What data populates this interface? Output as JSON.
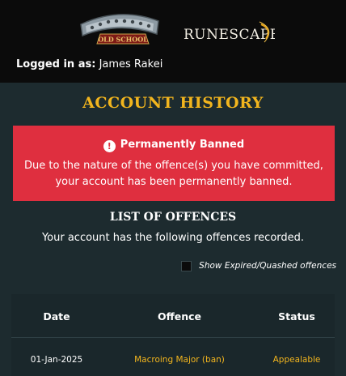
{
  "header": {
    "osrs_logo": {
      "text_top": "RuneScape",
      "text_bottom": "OLD SCHOOL"
    },
    "rs_logo": {
      "text": "RUNESCAPE"
    },
    "logged_in_label": "Logged in as:",
    "username": "James Rakei"
  },
  "page": {
    "title": "ACCOUNT HISTORY"
  },
  "ban_notice": {
    "icon": "exclamation-icon",
    "heading": "Permanently Banned",
    "message": "Due to the nature of the offence(s) you have committed, your account has been permanently banned.",
    "color": "#df2f3f"
  },
  "offences": {
    "title": "LIST OF OFFENCES",
    "subtitle": "Your account has the following offences recorded.",
    "show_expired_label": "Show Expired/Quashed offences",
    "show_expired_checked": false,
    "columns": [
      "Date",
      "Offence",
      "Status"
    ],
    "rows": [
      {
        "date": "01-Jan-2025",
        "offence": "Macroing Major (ban)",
        "status": "Appealable"
      }
    ]
  },
  "colors": {
    "accent": "#f2b51e",
    "background": "#1d2b2f",
    "header": "#0b0b0b"
  }
}
